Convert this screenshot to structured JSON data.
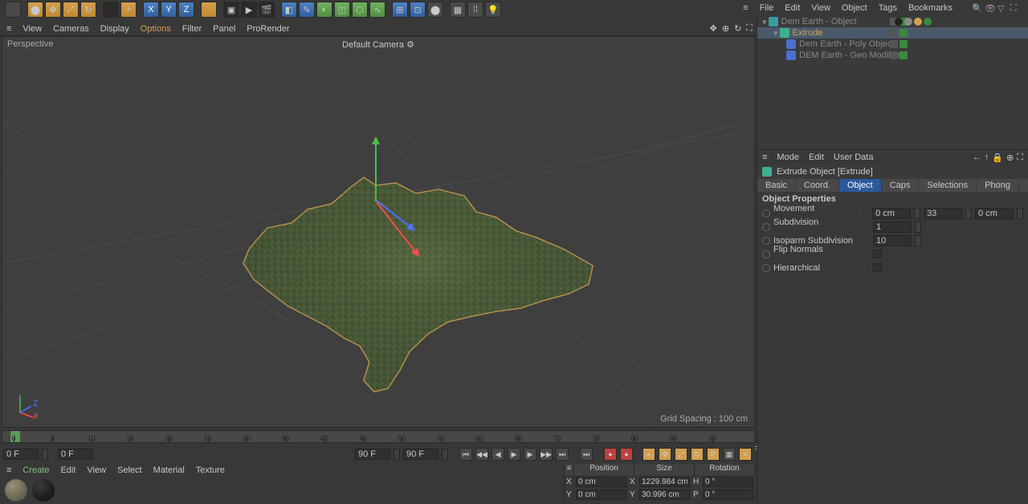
{
  "top_menu": {
    "file": "File",
    "edit": "Edit",
    "view": "View",
    "object": "Object",
    "tags": "Tags",
    "bookmarks": "Bookmarks"
  },
  "object_tree": {
    "items": [
      {
        "label": "Dem Earth - Object",
        "color": "#888",
        "icon": "#3a9aa0",
        "indent": 0
      },
      {
        "label": "Extrude",
        "color": "#d4a050",
        "icon": "#3ab090",
        "indent": 1,
        "selected": true
      },
      {
        "label": "Dem Earth - Poly Object",
        "color": "#888",
        "icon": "#4a70d0",
        "indent": 2
      },
      {
        "label": "DEM Earth - Geo Modifier",
        "color": "#888",
        "icon": "#4a70d0",
        "indent": 2
      }
    ]
  },
  "viewport_menu": {
    "view": "View",
    "cameras": "Cameras",
    "display": "Display",
    "options": "Options",
    "filter": "Filter",
    "panel": "Panel",
    "prorender": "ProRender"
  },
  "viewport": {
    "label": "Perspective",
    "camera": "Default Camera",
    "grid_spacing": "Grid Spacing : 100 cm"
  },
  "attr_menu": {
    "mode": "Mode",
    "edit": "Edit",
    "userdata": "User Data"
  },
  "attr": {
    "title": "Extrude Object [Extrude]",
    "tabs": {
      "basic": "Basic",
      "coord": "Coord.",
      "object": "Object",
      "caps": "Caps",
      "selections": "Selections",
      "phong": "Phong"
    },
    "section": "Object Properties",
    "movement_label": "Movement",
    "movement_x": "0 cm",
    "movement_y": "33",
    "movement_z": "0 cm",
    "subdivision_label": "Subdivision",
    "subdivision": "1",
    "isoparm_label": "Isoparm Subdivision",
    "isoparm": "10",
    "flipnormals_label": "Flip Normals",
    "hierarchical_label": "Hierarchical"
  },
  "timeline": {
    "ticks": [
      "0",
      "5",
      "10",
      "15",
      "20",
      "25",
      "30",
      "35",
      "40",
      "45",
      "50",
      "55",
      "60",
      "65",
      "70",
      "75",
      "80",
      "85",
      "90"
    ],
    "end_label": "0 F"
  },
  "frame": {
    "current": "0 F",
    "start": "0 F",
    "range_end": "90 F",
    "end": "90 F"
  },
  "bottom_menu": {
    "create": "Create",
    "edit": "Edit",
    "view": "View",
    "select": "Select",
    "material": "Material",
    "texture": "Texture"
  },
  "coord": {
    "headers": {
      "position": "Position",
      "size": "Size",
      "rotation": "Rotation"
    },
    "x": {
      "pos": "0 cm",
      "size": "1229.984 cm",
      "rot": "0 °"
    },
    "y": {
      "pos": "0 cm",
      "size": "30.996 cm",
      "rot": "0 °"
    }
  },
  "chart_data": null
}
